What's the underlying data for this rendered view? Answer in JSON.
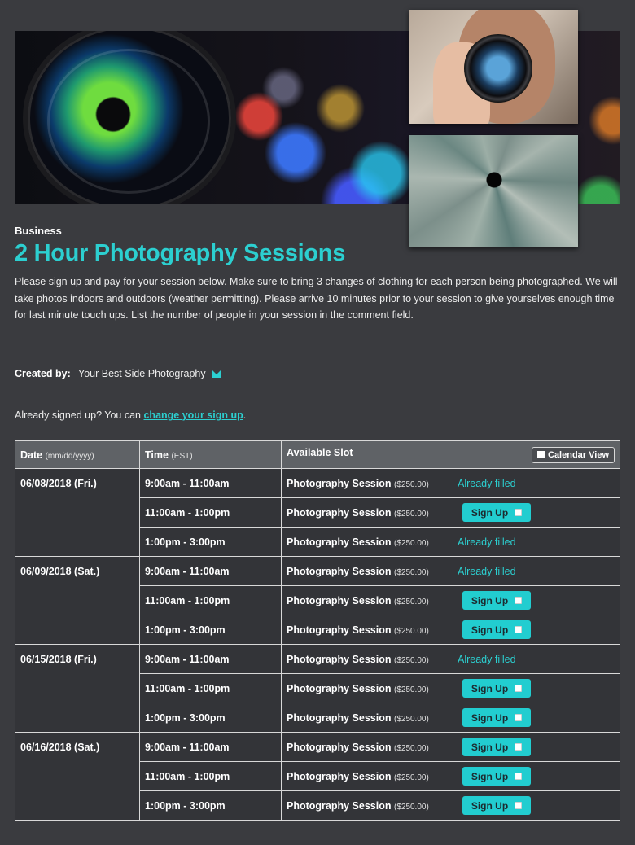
{
  "header": {
    "category": "Business",
    "title": "2 Hour Photography Sessions",
    "description": "Please sign up and pay for your session below. Make sure to bring 3 changes of clothing for each person being photographed. We will take photos indoors and outdoors (weather permitting). Please arrive 10 minutes prior to your session to give yourselves enough time for last minute touch ups. List the number of people in your session in the comment field.",
    "created_by_label": "Created by:",
    "created_by_name": "Your Best Side Photography"
  },
  "already": {
    "prefix": "Already signed up? You can",
    "link": "change your sign up",
    "suffix": "."
  },
  "table": {
    "date_header": "Date",
    "date_header_hint": "(mm/dd/yyyy)",
    "time_header": "Time",
    "time_header_hint": "(EST)",
    "slot_header": "Available Slot",
    "calendar_button": "Calendar View",
    "slot_name": "Photography Session",
    "slot_price": "($250.00)",
    "filled_label": "Already filled",
    "signup_label": "Sign Up",
    "rows": [
      {
        "date": "06/08/2018 (Fri.)",
        "time": "9:00am - 11:00am",
        "status": "filled"
      },
      {
        "date": "",
        "time": "11:00am - 1:00pm",
        "status": "open"
      },
      {
        "date": "",
        "time": "1:00pm - 3:00pm",
        "status": "filled"
      },
      {
        "date": "06/09/2018 (Sat.)",
        "time": "9:00am - 11:00am",
        "status": "filled"
      },
      {
        "date": "",
        "time": "11:00am - 1:00pm",
        "status": "open"
      },
      {
        "date": "",
        "time": "1:00pm - 3:00pm",
        "status": "open"
      },
      {
        "date": "06/15/2018 (Fri.)",
        "time": "9:00am - 11:00am",
        "status": "filled"
      },
      {
        "date": "",
        "time": "11:00am - 1:00pm",
        "status": "open"
      },
      {
        "date": "",
        "time": "1:00pm - 3:00pm",
        "status": "open"
      },
      {
        "date": "06/16/2018 (Sat.)",
        "time": "9:00am - 11:00am",
        "status": "open"
      },
      {
        "date": "",
        "time": "11:00am - 1:00pm",
        "status": "open"
      },
      {
        "date": "",
        "time": "1:00pm - 3:00pm",
        "status": "open"
      }
    ]
  },
  "colors": {
    "accent": "#2ccfd0",
    "background": "#3a3b3f",
    "header_row": "#5f6266"
  },
  "icons": {
    "email": "envelope-icon",
    "calendar": "calendar-icon",
    "checkbox": "checkbox-icon"
  }
}
